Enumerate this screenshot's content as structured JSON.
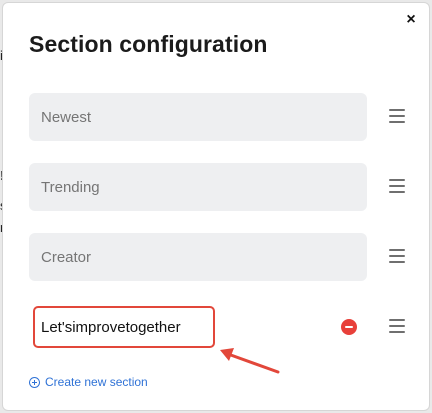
{
  "dialog": {
    "title": "Section configuration",
    "close_glyph": "×"
  },
  "sections": [
    {
      "placeholder": "Newest",
      "value": ""
    },
    {
      "placeholder": "Trending",
      "value": ""
    },
    {
      "placeholder": "Creator",
      "value": ""
    },
    {
      "placeholder": "",
      "value": "Let'simprovetogether"
    }
  ],
  "actions": {
    "create_new_section": "Create new section"
  },
  "colors": {
    "accent": "#2f72d6",
    "danger": "#e8403a",
    "annotation": "#e2473a"
  }
}
